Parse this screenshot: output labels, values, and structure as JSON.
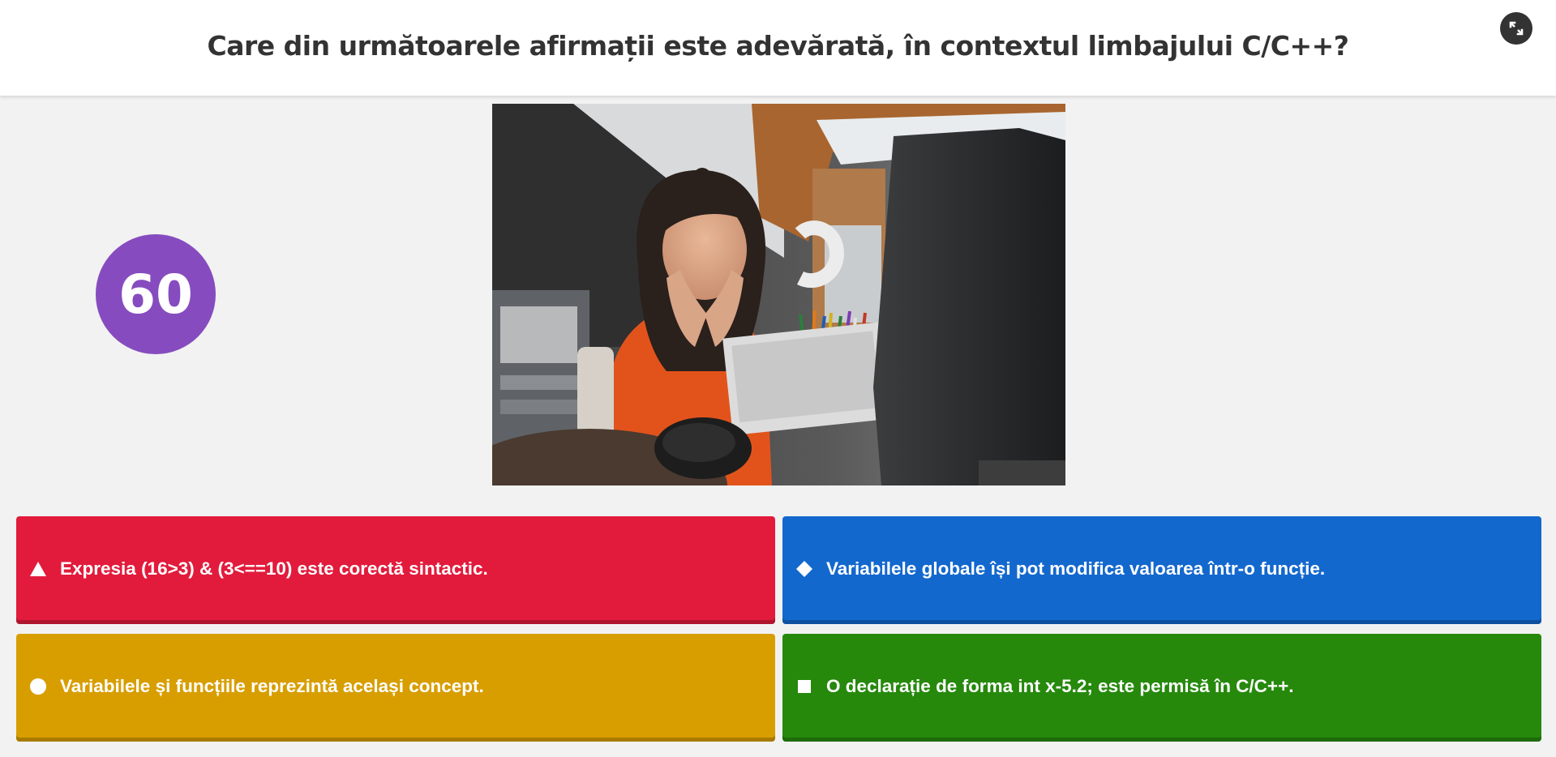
{
  "question": {
    "text": "Care din următoarele afirmații este adevărată, în contextul limbajului C/C++?"
  },
  "timer": {
    "value": "60",
    "color": "#864cbf"
  },
  "media": {
    "icon": "photo-student-at-laptop"
  },
  "controls": {
    "fullscreen_icon": "fullscreen-icon"
  },
  "answers": [
    {
      "shape": "triangle",
      "color": "#e21b3c",
      "text": "Expresia (16>3) & (3<==10) este corectă sintactic."
    },
    {
      "shape": "diamond",
      "color": "#1368ce",
      "text": "Variabilele globale își pot modifica valoarea într-o funcție."
    },
    {
      "shape": "circle",
      "color": "#d89e00",
      "text": "Variabilele și funcțiile reprezintă același concept."
    },
    {
      "shape": "square",
      "color": "#26890c",
      "text": "O declarație de forma int x-5.2; este permisă în C/C++."
    }
  ]
}
